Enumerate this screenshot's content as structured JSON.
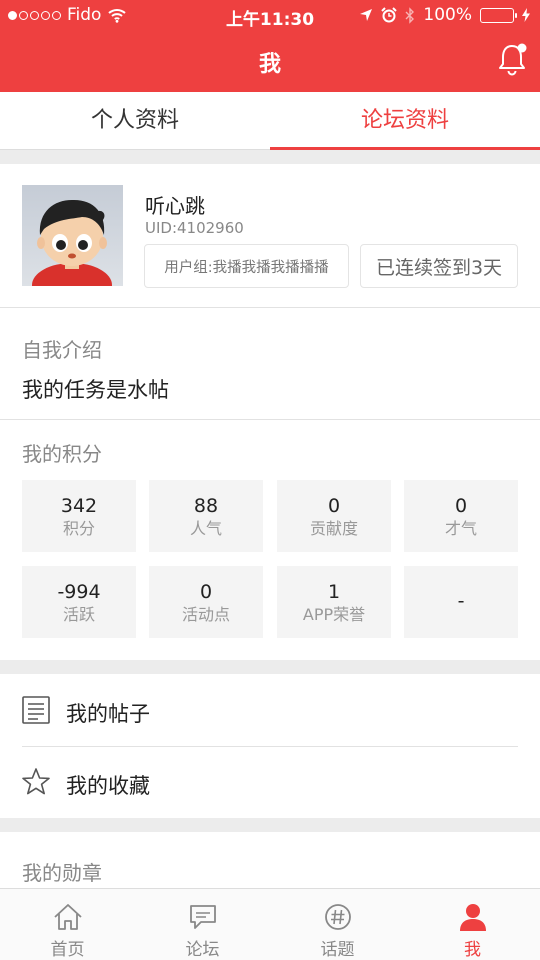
{
  "status_bar": {
    "carrier": "Fido",
    "time": "上午11:30",
    "battery": "100%",
    "battery_level": 1.0,
    "signal_dots_filled": 1,
    "signal_dots_total": 5
  },
  "nav": {
    "title": "我",
    "bell_icon": "bell-icon"
  },
  "tabs": [
    {
      "label": "个人资料",
      "active": false
    },
    {
      "label": "论坛资料",
      "active": true
    }
  ],
  "profile": {
    "username": "听心跳",
    "uid": "UID:4102960",
    "user_group": "用户组:我播我播我播播播",
    "sign_in": "已连续签到3天"
  },
  "intro": {
    "label": "自我介绍",
    "text": "我的任务是水帖"
  },
  "points": {
    "label": "我的积分",
    "items": [
      {
        "value": "342",
        "label": "积分"
      },
      {
        "value": "88",
        "label": "人气"
      },
      {
        "value": "0",
        "label": "贡献度"
      },
      {
        "value": "0",
        "label": "才气"
      },
      {
        "value": "-994",
        "label": "活跃"
      },
      {
        "value": "0",
        "label": "活动点"
      },
      {
        "value": "1",
        "label": "APP荣誉"
      },
      {
        "value": "-",
        "label": ""
      }
    ]
  },
  "menu": [
    {
      "label": "我的帖子",
      "icon": "document-icon"
    },
    {
      "label": "我的收藏",
      "icon": "star-icon"
    }
  ],
  "medals": {
    "label": "我的勋章"
  },
  "tabbar": [
    {
      "label": "首页",
      "icon": "home-icon",
      "active": false
    },
    {
      "label": "论坛",
      "icon": "chat-icon",
      "active": false
    },
    {
      "label": "话题",
      "icon": "hashtag-icon",
      "active": false
    },
    {
      "label": "我",
      "icon": "person-icon",
      "active": true
    }
  ],
  "colors": {
    "accent": "#ee4040",
    "battery_fill": "#4cd964"
  }
}
